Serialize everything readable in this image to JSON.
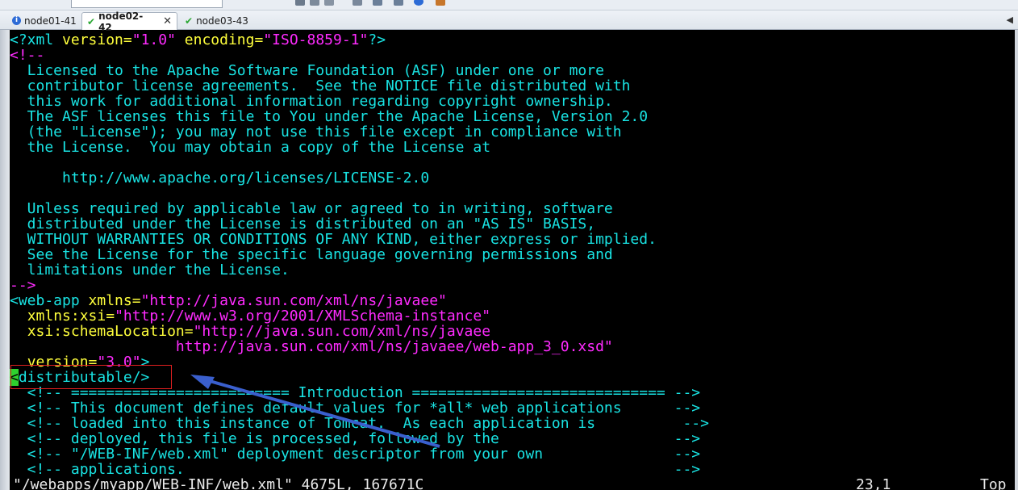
{
  "tabs": [
    {
      "label": "node01-41",
      "icon": "info-icon",
      "active": false
    },
    {
      "label": "node02-42",
      "icon": "check-icon",
      "active": true
    },
    {
      "label": "node03-43",
      "icon": "check-icon",
      "active": false
    }
  ],
  "editor": {
    "lines": [
      [
        [
          "tag",
          "<?xml "
        ],
        [
          "attr",
          "version="
        ],
        [
          "str",
          "\"1.0\""
        ],
        [
          "tag",
          " "
        ],
        [
          "attr",
          "encoding="
        ],
        [
          "str",
          "\"ISO-8859-1\""
        ],
        [
          "tag",
          "?>"
        ]
      ],
      [
        [
          "str",
          "<!--"
        ]
      ],
      [
        [
          "cm",
          "  Licensed to the Apache Software Foundation (ASF) under one or more"
        ]
      ],
      [
        [
          "cm",
          "  contributor license agreements.  See the NOTICE file distributed with"
        ]
      ],
      [
        [
          "cm",
          "  this work for additional information regarding copyright ownership."
        ]
      ],
      [
        [
          "cm",
          "  The ASF licenses this file to You under the Apache License, Version 2.0"
        ]
      ],
      [
        [
          "cm",
          "  (the \"License\"); you may not use this file except in compliance with"
        ]
      ],
      [
        [
          "cm",
          "  the License.  You may obtain a copy of the License at"
        ]
      ],
      [
        [
          "cm",
          ""
        ]
      ],
      [
        [
          "cm",
          "      http://www.apache.org/licenses/LICENSE-2.0"
        ]
      ],
      [
        [
          "cm",
          ""
        ]
      ],
      [
        [
          "cm",
          "  Unless required by applicable law or agreed to in writing, software"
        ]
      ],
      [
        [
          "cm",
          "  distributed under the License is distributed on an \"AS IS\" BASIS,"
        ]
      ],
      [
        [
          "cm",
          "  WITHOUT WARRANTIES OR CONDITIONS OF ANY KIND, either express or implied."
        ]
      ],
      [
        [
          "cm",
          "  See the License for the specific language governing permissions and"
        ]
      ],
      [
        [
          "cm",
          "  limitations under the License."
        ]
      ],
      [
        [
          "str",
          "-->"
        ]
      ],
      [
        [
          "tag",
          "<web-app "
        ],
        [
          "attr",
          "xmlns="
        ],
        [
          "str",
          "\"http://java.sun.com/xml/ns/javaee\""
        ]
      ],
      [
        [
          "tag",
          "  "
        ],
        [
          "attr",
          "xmlns:xsi="
        ],
        [
          "str",
          "\"http://www.w3.org/2001/XMLSchema-instance\""
        ]
      ],
      [
        [
          "tag",
          "  "
        ],
        [
          "attr",
          "xsi:schemaLocation="
        ],
        [
          "str",
          "\"http://java.sun.com/xml/ns/javaee"
        ]
      ],
      [
        [
          "str",
          "                   http://java.sun.com/xml/ns/javaee/web-app_3_0.xsd\""
        ]
      ],
      [
        [
          "tag",
          "  "
        ],
        [
          "attr",
          "version="
        ],
        [
          "str",
          "\"3.0\""
        ],
        [
          "tag",
          ">"
        ]
      ],
      [
        [
          "cursor",
          "<"
        ],
        [
          "tag",
          "distributable/>"
        ]
      ],
      [
        [
          "cm",
          "  <!-- ========================= Introduction ============================= -->"
        ]
      ],
      [
        [
          "cm",
          "  <!-- This document defines default values for *all* web applications      -->"
        ]
      ],
      [
        [
          "cm",
          "  <!-- loaded into this instance of Tomcat.  As each application is          -->"
        ]
      ],
      [
        [
          "cm",
          "  <!-- deployed, this file is processed, followed by the                    -->"
        ]
      ],
      [
        [
          "cm",
          "  <!-- \"/WEB-INF/web.xml\" deployment descriptor from your own               -->"
        ]
      ],
      [
        [
          "cm",
          "  <!-- applications.                                                        -->"
        ]
      ]
    ],
    "status_left": "\"/webapps/myapp/WEB-INF/web.xml\" 4675L, 167671C",
    "status_pos": "23,1",
    "status_scroll": "Top"
  },
  "colors": {
    "background": "#000000",
    "comment": "#19e3e3",
    "string": "#ff2bff",
    "attribute": "#ffff3c",
    "cursor": "#2ed12e",
    "annotation_box": "#e02020",
    "annotation_arrow": "#3a5fcd"
  }
}
